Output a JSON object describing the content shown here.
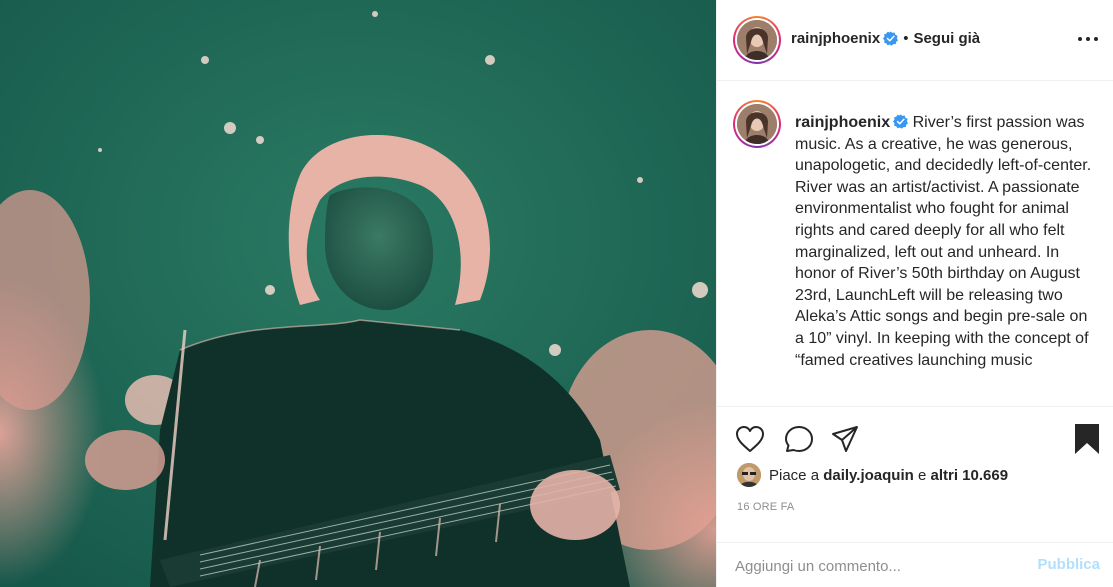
{
  "post": {
    "author": {
      "username": "rainjphoenix",
      "verified": true,
      "follow_state": "Segui già",
      "separator": "•"
    },
    "caption": {
      "username": "rainjphoenix",
      "text": "River’s first passion was music. As a creative, he was generous, unapologetic, and decidedly left-of-center. River was an artist/activist. A passionate environmentalist who fought for animal rights and cared deeply for all who felt marginalized, left out and unheard. In honor of River’s 50th birthday on August 23rd, LaunchLeft will be releasing two Aleka’s Attic songs and begin pre-sale on a 10” vinyl. In keeping with the concept of “famed creatives launching music"
    },
    "likes": {
      "prefix": "Piace a",
      "liked_by": "daily.joaquin",
      "conjunction": "e",
      "others": "altri 10.669"
    },
    "timestamp": "16 ORE FA",
    "comment": {
      "placeholder": "Aggiungi un commento...",
      "publish_label": "Pubblica"
    }
  },
  "icons": {
    "verified": "verified-badge-icon",
    "more": "more-options-icon",
    "like": "heart-icon",
    "comment": "comment-bubble-icon",
    "share": "paper-plane-icon",
    "save": "bookmark-icon"
  },
  "colors": {
    "verified_blue": "#3897f0",
    "publish_disabled": "#b2dffc",
    "muted_text": "#8e8e8e",
    "photo_green": "#1f6a57"
  }
}
